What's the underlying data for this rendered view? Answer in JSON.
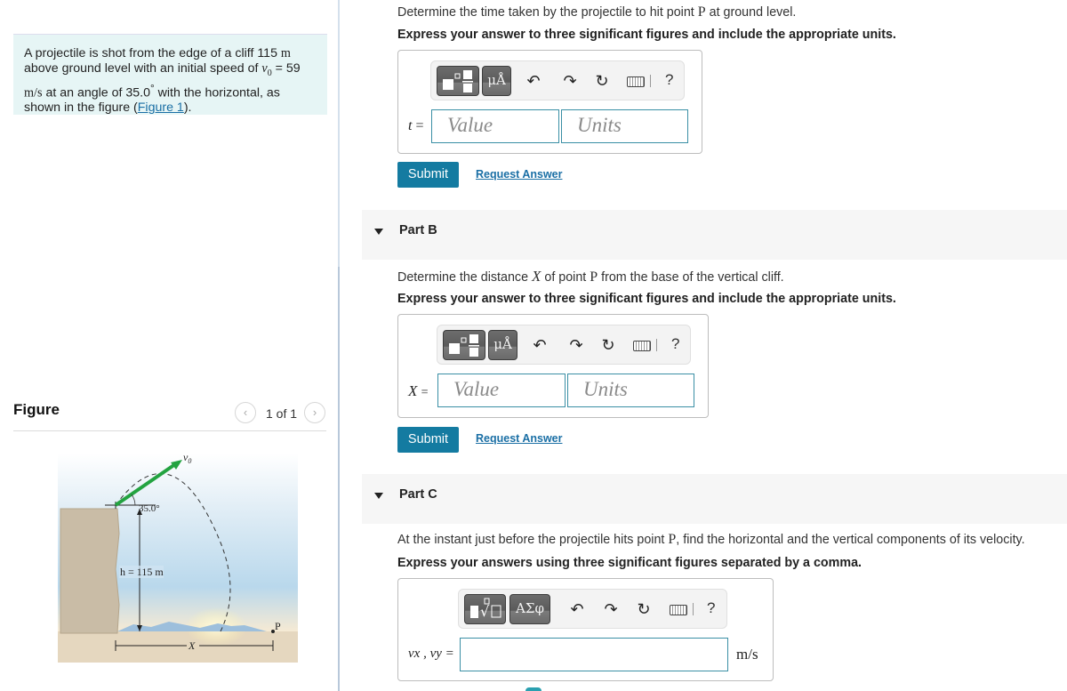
{
  "intro": {
    "text_1": "A projectile is shot from the edge of a cliff 115 ",
    "unit_m": "m",
    "text_2": " above ground level with an initial speed of ",
    "v0_symbol": "v",
    "v0_sub": "0",
    "text_3": " = 59 ",
    "speed_unit": "m/s",
    "text_4": " at an angle of 35.0",
    "degree": "°",
    "text_5": " with the horizontal, as shown in the figure (",
    "figure_link": "Figure 1",
    "text_6": ")."
  },
  "figure": {
    "title": "Figure",
    "page_indicator": "1 of 1",
    "prev_icon": "‹",
    "next_icon": "›",
    "labels": {
      "v0": "v",
      "v0_sub": "0",
      "angle": "35.0°",
      "height": "h = 115 m",
      "point": "P",
      "distance": "X"
    }
  },
  "partA": {
    "question_1": "Determine the time taken by the projectile to hit point ",
    "point": "P",
    "question_2": " at ground level.",
    "instruction": "Express your answer to three significant figures and include the appropriate units.",
    "toolbar": {
      "btn1_glyph": "▪▫",
      "btn2_glyph": "μÅ",
      "undo": "↶",
      "redo": "↷",
      "reset": "↻",
      "help": "?"
    },
    "variable": "t",
    "equals": "=",
    "value_placeholder": "Value",
    "units_placeholder": "Units",
    "submit_label": "Submit",
    "request_label": "Request Answer"
  },
  "partB": {
    "header": "Part B",
    "question_1": "Determine the distance ",
    "var_X": "X",
    "question_2": " of point ",
    "point": "P",
    "question_3": " from the base of the vertical cliff.",
    "instruction": "Express your answer to three significant figures and include the appropriate units.",
    "toolbar": {
      "btn2_glyph": "μÅ",
      "undo": "↶",
      "redo": "↷",
      "reset": "↻",
      "help": "?"
    },
    "variable": "X",
    "equals": "=",
    "value_placeholder": "Value",
    "units_placeholder": "Units",
    "submit_label": "Submit",
    "request_label": "Request Answer"
  },
  "partC": {
    "header": "Part C",
    "question_1": "At the instant just before the projectile hits point ",
    "point": "P",
    "question_2": ", find the horizontal and the vertical components of its velocity.",
    "instruction": "Express your answers using three significant figures separated by a comma.",
    "toolbar": {
      "btn1_glyph": "√",
      "btn2_glyph": "ΑΣφ",
      "undo": "↶",
      "redo": "↷",
      "reset": "↻",
      "help": "?"
    },
    "variable_label": "vx , vy =",
    "value": "",
    "unit": "m/s"
  }
}
